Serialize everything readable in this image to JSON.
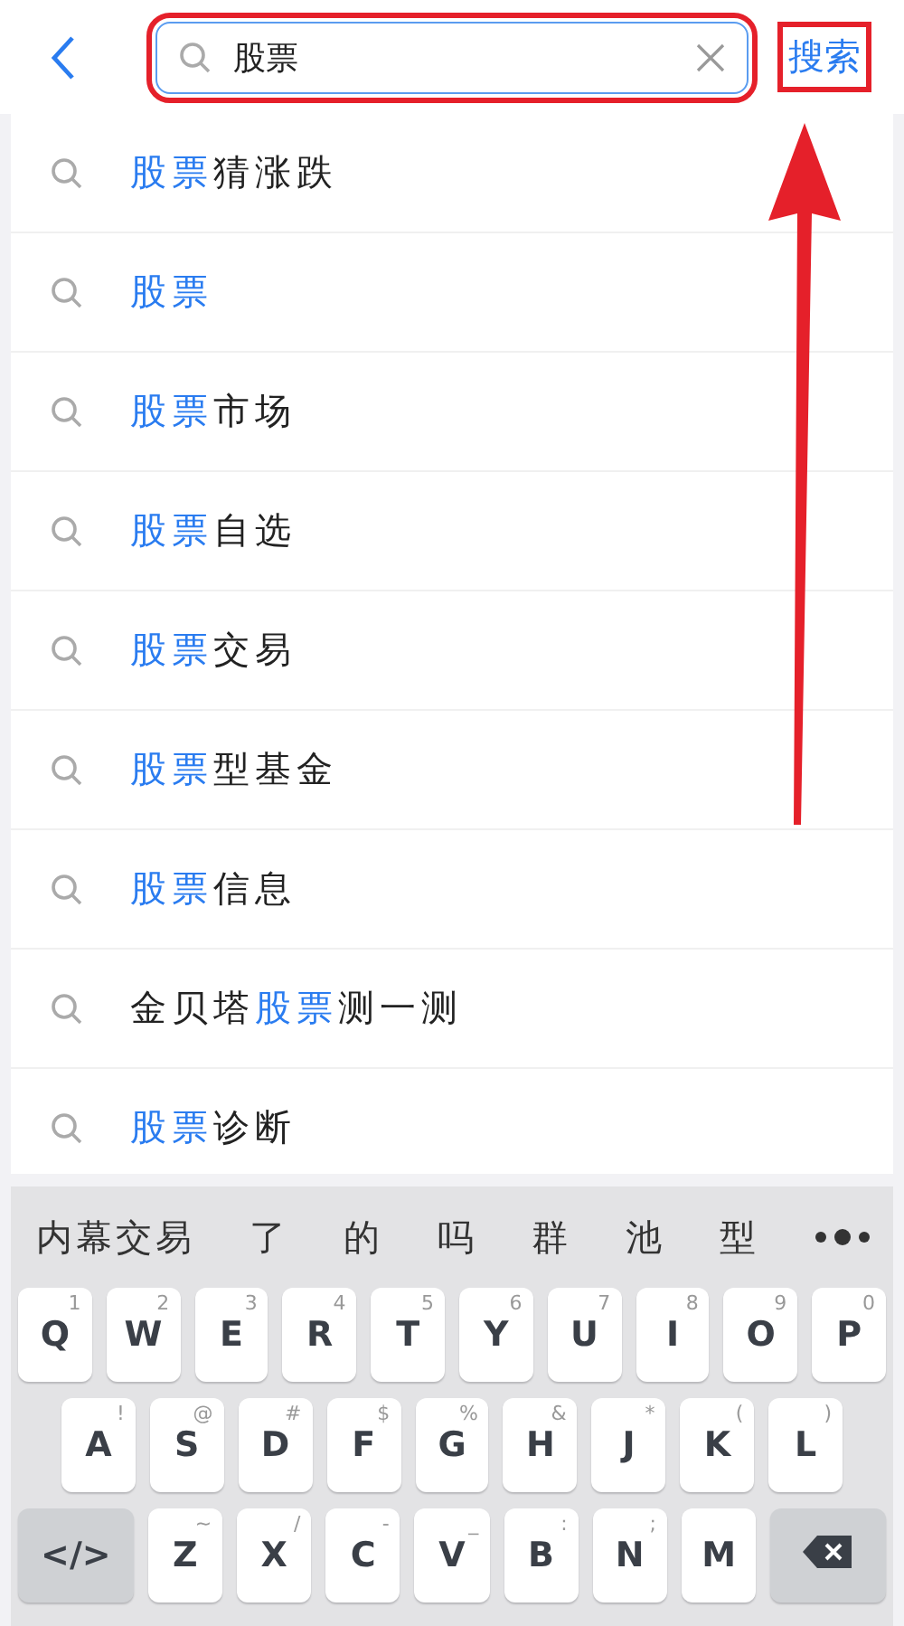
{
  "header": {
    "search": {
      "value": "股票"
    },
    "search_button": "搜索"
  },
  "suggestions": [
    {
      "parts": [
        {
          "text": "股票",
          "highlight": true
        },
        {
          "text": "猜涨跌",
          "highlight": false
        }
      ]
    },
    {
      "parts": [
        {
          "text": "股票",
          "highlight": true
        }
      ]
    },
    {
      "parts": [
        {
          "text": "股票",
          "highlight": true
        },
        {
          "text": "市场",
          "highlight": false
        }
      ]
    },
    {
      "parts": [
        {
          "text": "股票",
          "highlight": true
        },
        {
          "text": "自选",
          "highlight": false
        }
      ]
    },
    {
      "parts": [
        {
          "text": "股票",
          "highlight": true
        },
        {
          "text": "交易",
          "highlight": false
        }
      ]
    },
    {
      "parts": [
        {
          "text": "股票",
          "highlight": true
        },
        {
          "text": "型基金",
          "highlight": false
        }
      ]
    },
    {
      "parts": [
        {
          "text": "股票",
          "highlight": true
        },
        {
          "text": "信息",
          "highlight": false
        }
      ]
    },
    {
      "parts": [
        {
          "text": "金贝塔",
          "highlight": false
        },
        {
          "text": "股票",
          "highlight": true
        },
        {
          "text": "测一测",
          "highlight": false
        }
      ]
    },
    {
      "parts": [
        {
          "text": "股票",
          "highlight": true
        },
        {
          "text": "诊断",
          "highlight": false
        }
      ]
    }
  ],
  "keyboard": {
    "candidates": [
      "内幕交易",
      "了",
      "的",
      "吗",
      "群",
      "池",
      "型"
    ],
    "rows": [
      [
        {
          "kind": "letter",
          "label": "Q",
          "hint": "1"
        },
        {
          "kind": "letter",
          "label": "W",
          "hint": "2"
        },
        {
          "kind": "letter",
          "label": "E",
          "hint": "3"
        },
        {
          "kind": "letter",
          "label": "R",
          "hint": "4"
        },
        {
          "kind": "letter",
          "label": "T",
          "hint": "5"
        },
        {
          "kind": "letter",
          "label": "Y",
          "hint": "6"
        },
        {
          "kind": "letter",
          "label": "U",
          "hint": "7"
        },
        {
          "kind": "letter",
          "label": "I",
          "hint": "8"
        },
        {
          "kind": "letter",
          "label": "O",
          "hint": "9"
        },
        {
          "kind": "letter",
          "label": "P",
          "hint": "0"
        }
      ],
      [
        {
          "kind": "letter",
          "label": "A",
          "hint": "!"
        },
        {
          "kind": "letter",
          "label": "S",
          "hint": "@"
        },
        {
          "kind": "letter",
          "label": "D",
          "hint": "#"
        },
        {
          "kind": "letter",
          "label": "F",
          "hint": "$"
        },
        {
          "kind": "letter",
          "label": "G",
          "hint": "%"
        },
        {
          "kind": "letter",
          "label": "H",
          "hint": "&"
        },
        {
          "kind": "letter",
          "label": "J",
          "hint": "*"
        },
        {
          "kind": "letter",
          "label": "K",
          "hint": "("
        },
        {
          "kind": "letter",
          "label": "L",
          "hint": ")"
        }
      ],
      [
        {
          "kind": "function",
          "label": "</>"
        },
        {
          "kind": "letter",
          "label": "Z",
          "hint": "~"
        },
        {
          "kind": "letter",
          "label": "X",
          "hint": "/"
        },
        {
          "kind": "letter",
          "label": "C",
          "hint": "-"
        },
        {
          "kind": "letter",
          "label": "V",
          "hint": "_"
        },
        {
          "kind": "letter",
          "label": "B",
          "hint": ":"
        },
        {
          "kind": "letter",
          "label": "N",
          "hint": ";"
        },
        {
          "kind": "letter",
          "label": "M"
        },
        {
          "kind": "delete"
        }
      ]
    ]
  }
}
